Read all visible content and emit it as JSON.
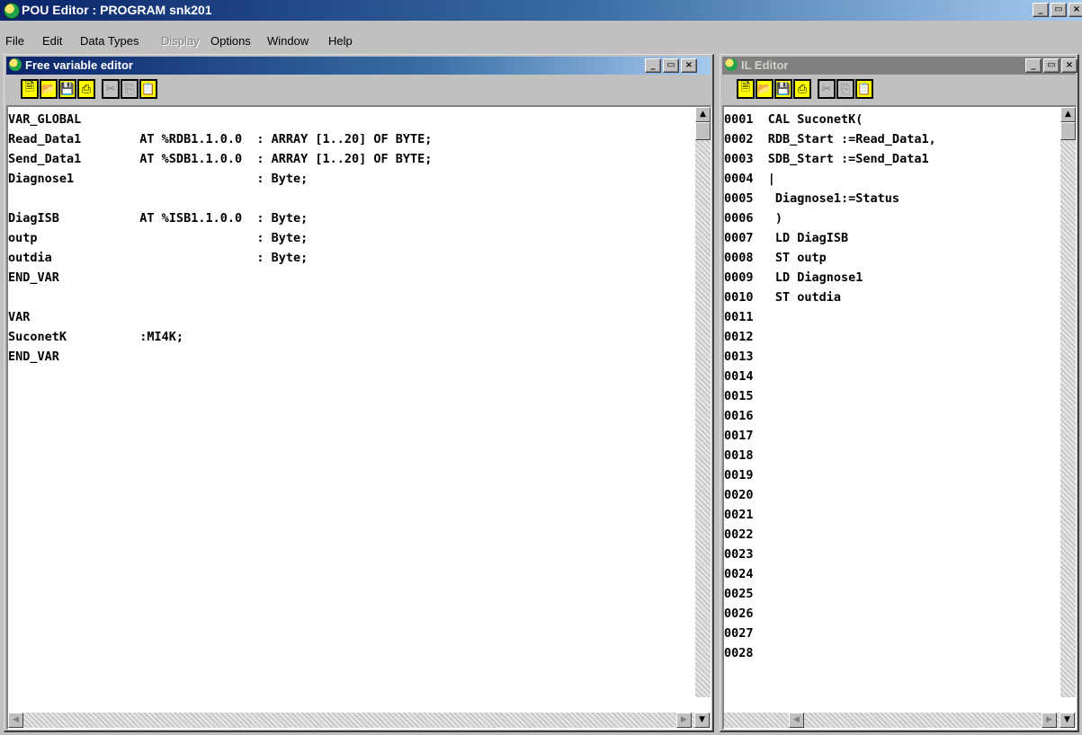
{
  "app": {
    "title": "POU Editor : PROGRAM snk201",
    "window_controls": {
      "minimize": "_",
      "restore": "▭",
      "close": "×"
    }
  },
  "menu": [
    {
      "label": "File",
      "enabled": true
    },
    {
      "label": "Edit",
      "enabled": true
    },
    {
      "label": "Data Types",
      "enabled": true
    },
    {
      "label": "Display",
      "enabled": false
    },
    {
      "label": "Options",
      "enabled": true
    },
    {
      "label": "Window",
      "enabled": true
    },
    {
      "label": "Help",
      "enabled": true
    }
  ],
  "var_editor": {
    "title": "Free variable editor",
    "lines": [
      "VAR_GLOBAL",
      "Read_Data1        AT %RDB1.1.0.0  : ARRAY [1..20] OF BYTE;",
      "Send_Data1        AT %SDB1.1.0.0  : ARRAY [1..20] OF BYTE;",
      "Diagnose1                         : Byte;",
      "",
      "DiagISB           AT %ISB1.1.0.0  : Byte;",
      "outp                              : Byte;",
      "outdia                            : Byte;",
      "END_VAR",
      "",
      "VAR",
      "SuconetK          :MI4K;",
      "END_VAR"
    ]
  },
  "il_editor": {
    "title": "IL Editor",
    "lines": [
      "0001  CAL SuconetK(",
      "0002  RDB_Start :=Read_Data1,",
      "0003  SDB_Start :=Send_Data1",
      "0004  |",
      "0005   Diagnose1:=Status",
      "0006   )",
      "0007   LD DiagISB",
      "0008   ST outp",
      "0009   LD Diagnose1",
      "0010   ST outdia",
      "0011",
      "0012",
      "0013",
      "0014",
      "0015",
      "0016",
      "0017",
      "0018",
      "0019",
      "0020",
      "0021",
      "0022",
      "0023",
      "0024",
      "0025",
      "0026",
      "0027",
      "0028"
    ]
  },
  "toolbar_icons": [
    "new-icon",
    "open-icon",
    "save-icon",
    "print-icon",
    "cut-icon",
    "copy-icon",
    "paste-icon"
  ],
  "colors": {
    "title_active": "#0a246a",
    "toolbar_button": "#ffff00",
    "window_face": "#c0c0c0"
  }
}
